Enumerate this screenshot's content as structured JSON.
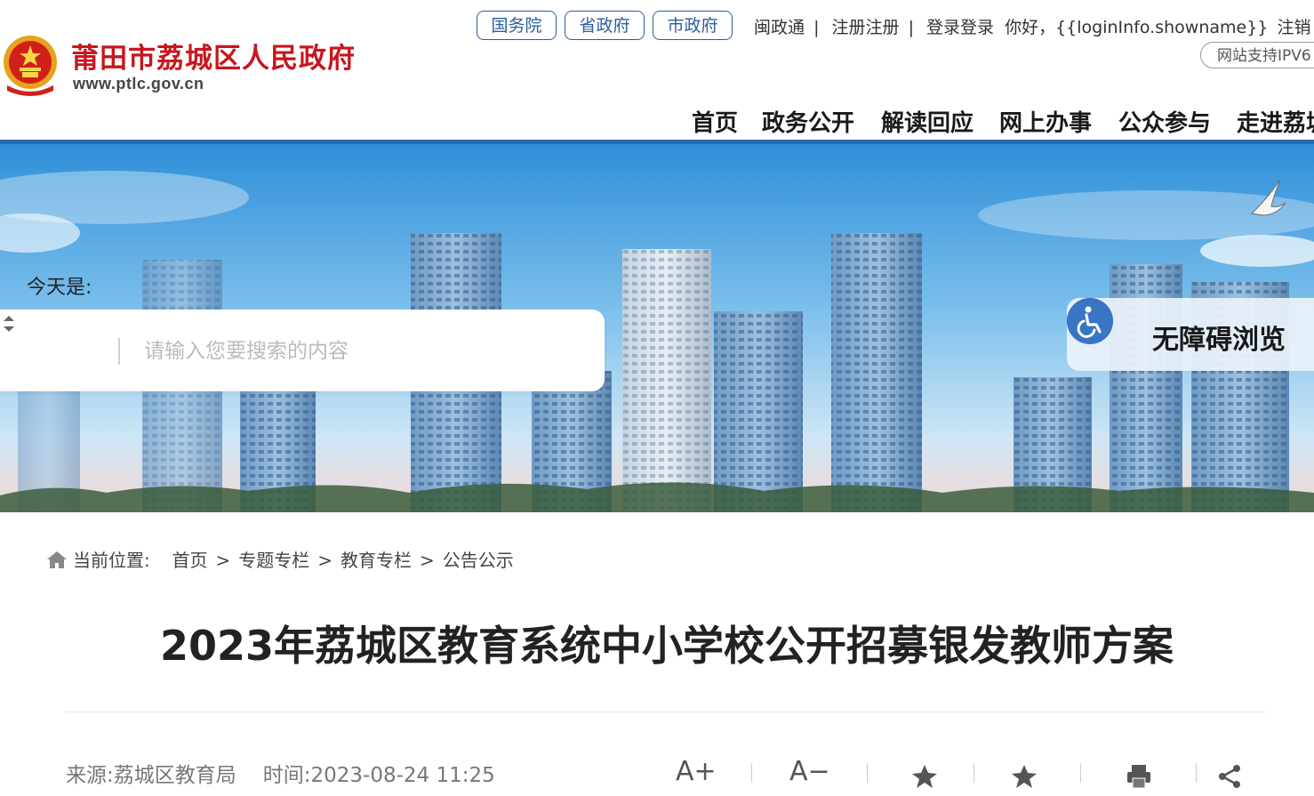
{
  "header": {
    "site_name": "莆田市荔城区人民政府",
    "domain": "www.ptlc.gov.cn",
    "gov_links": [
      "国务院",
      "省政府",
      "市政府"
    ],
    "top_links": {
      "minzhengtong": "闽政通",
      "register": "注册注册",
      "login": "登录登录",
      "greeting": "你好，{{loginInfo.showname}}",
      "logout": "注销"
    },
    "separator": "|",
    "ipv6": "网站支持IPV6"
  },
  "nav": [
    "首页",
    "政务公开",
    "解读回应",
    "网上办事",
    "公众参与",
    "走进荔城"
  ],
  "banner": {
    "today_label": "今天是:",
    "search_placeholder": "请输入您要搜索的内容",
    "accessibility_label": "无障碍浏览"
  },
  "breadcrumb": {
    "label": "当前位置:",
    "items": [
      "首页",
      "专题专栏",
      "教育专栏",
      "公告公示"
    ],
    "separator": ">"
  },
  "article": {
    "title": "2023年荔城区教育系统中小学校公开招募银发教师方案",
    "source": "来源:荔城区教育局",
    "time_label": "时间:",
    "time": "2023-08-24 11:25"
  },
  "tools": {
    "font_increase": "A+",
    "font_decrease": "A−",
    "icons": [
      "favorite-icon",
      "collect-icon",
      "print-icon",
      "share-icon"
    ]
  },
  "colors": {
    "brand_red": "#c8161d",
    "nav_blue": "#2a6ab2",
    "link_blue": "#2a5f9e",
    "accessibility_blue": "#3a74c4"
  }
}
